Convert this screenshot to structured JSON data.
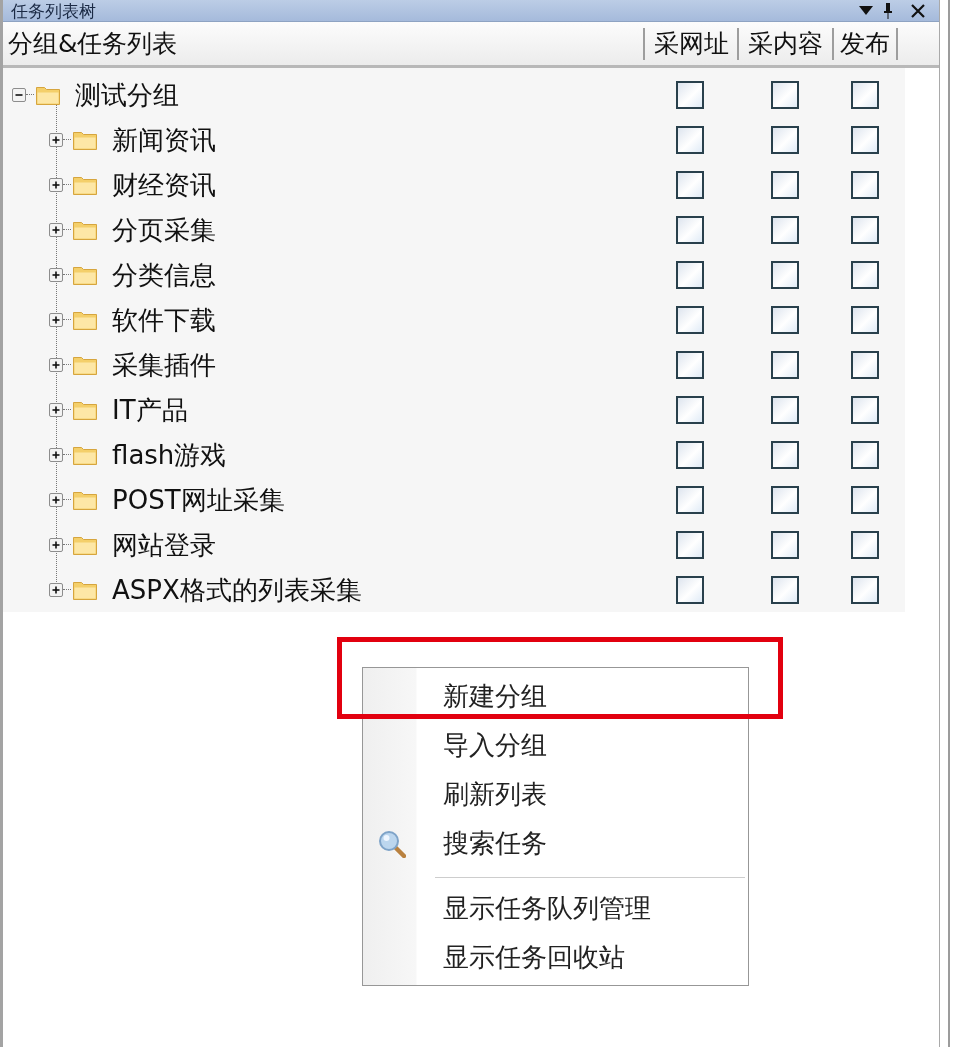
{
  "panel": {
    "title": "任务列表树"
  },
  "columns": [
    {
      "label": "分组&任务列表"
    },
    {
      "label": "采网址"
    },
    {
      "label": "采内容"
    },
    {
      "label": "发布"
    }
  ],
  "tree": [
    {
      "label": "测试分组",
      "expanded": true,
      "checks": [
        {
          "checked": false
        },
        {
          "checked": false
        },
        {
          "checked": false
        }
      ],
      "children": [
        {
          "label": "新闻资讯",
          "expanded": false,
          "checks": [
            {
              "checked": false
            },
            {
              "checked": false
            },
            {
              "checked": false
            }
          ]
        },
        {
          "label": "财经资讯",
          "expanded": false,
          "checks": [
            {
              "checked": false
            },
            {
              "checked": false
            },
            {
              "checked": false
            }
          ]
        },
        {
          "label": "分页采集",
          "expanded": false,
          "checks": [
            {
              "checked": false
            },
            {
              "checked": false
            },
            {
              "checked": false
            }
          ]
        },
        {
          "label": "分类信息",
          "expanded": false,
          "checks": [
            {
              "checked": false
            },
            {
              "checked": false
            },
            {
              "checked": false
            }
          ]
        },
        {
          "label": "软件下载",
          "expanded": false,
          "checks": [
            {
              "checked": false
            },
            {
              "checked": false
            },
            {
              "checked": false
            }
          ]
        },
        {
          "label": "采集插件",
          "expanded": false,
          "checks": [
            {
              "checked": false
            },
            {
              "checked": false
            },
            {
              "checked": false
            }
          ]
        },
        {
          "label": "IT产品",
          "expanded": false,
          "checks": [
            {
              "checked": false
            },
            {
              "checked": false
            },
            {
              "checked": false
            }
          ]
        },
        {
          "label": "flash游戏",
          "expanded": false,
          "checks": [
            {
              "checked": false
            },
            {
              "checked": false
            },
            {
              "checked": false
            }
          ]
        },
        {
          "label": "POST网址采集",
          "expanded": false,
          "checks": [
            {
              "checked": false
            },
            {
              "checked": false
            },
            {
              "checked": false
            }
          ]
        },
        {
          "label": "网站登录",
          "expanded": false,
          "checks": [
            {
              "checked": false
            },
            {
              "checked": false
            },
            {
              "checked": false
            }
          ]
        },
        {
          "label": "ASPX格式的列表采集",
          "expanded": false,
          "checks": [
            {
              "checked": false
            },
            {
              "checked": false
            },
            {
              "checked": false
            }
          ]
        }
      ]
    }
  ],
  "context_menu": {
    "items": [
      {
        "kind": "item",
        "label": "新建分组",
        "has_icon": false,
        "highlighted": true
      },
      {
        "kind": "item",
        "label": "导入分组",
        "has_icon": false,
        "highlighted": false
      },
      {
        "kind": "item",
        "label": "刷新列表",
        "has_icon": false,
        "highlighted": false
      },
      {
        "kind": "item",
        "label": "搜索任务",
        "has_icon": true,
        "highlighted": false
      },
      {
        "kind": "separator"
      },
      {
        "kind": "item",
        "label": "显示任务队列管理",
        "has_icon": false,
        "highlighted": false
      },
      {
        "kind": "item",
        "label": "显示任务回收站",
        "has_icon": false,
        "highlighted": false
      }
    ]
  }
}
